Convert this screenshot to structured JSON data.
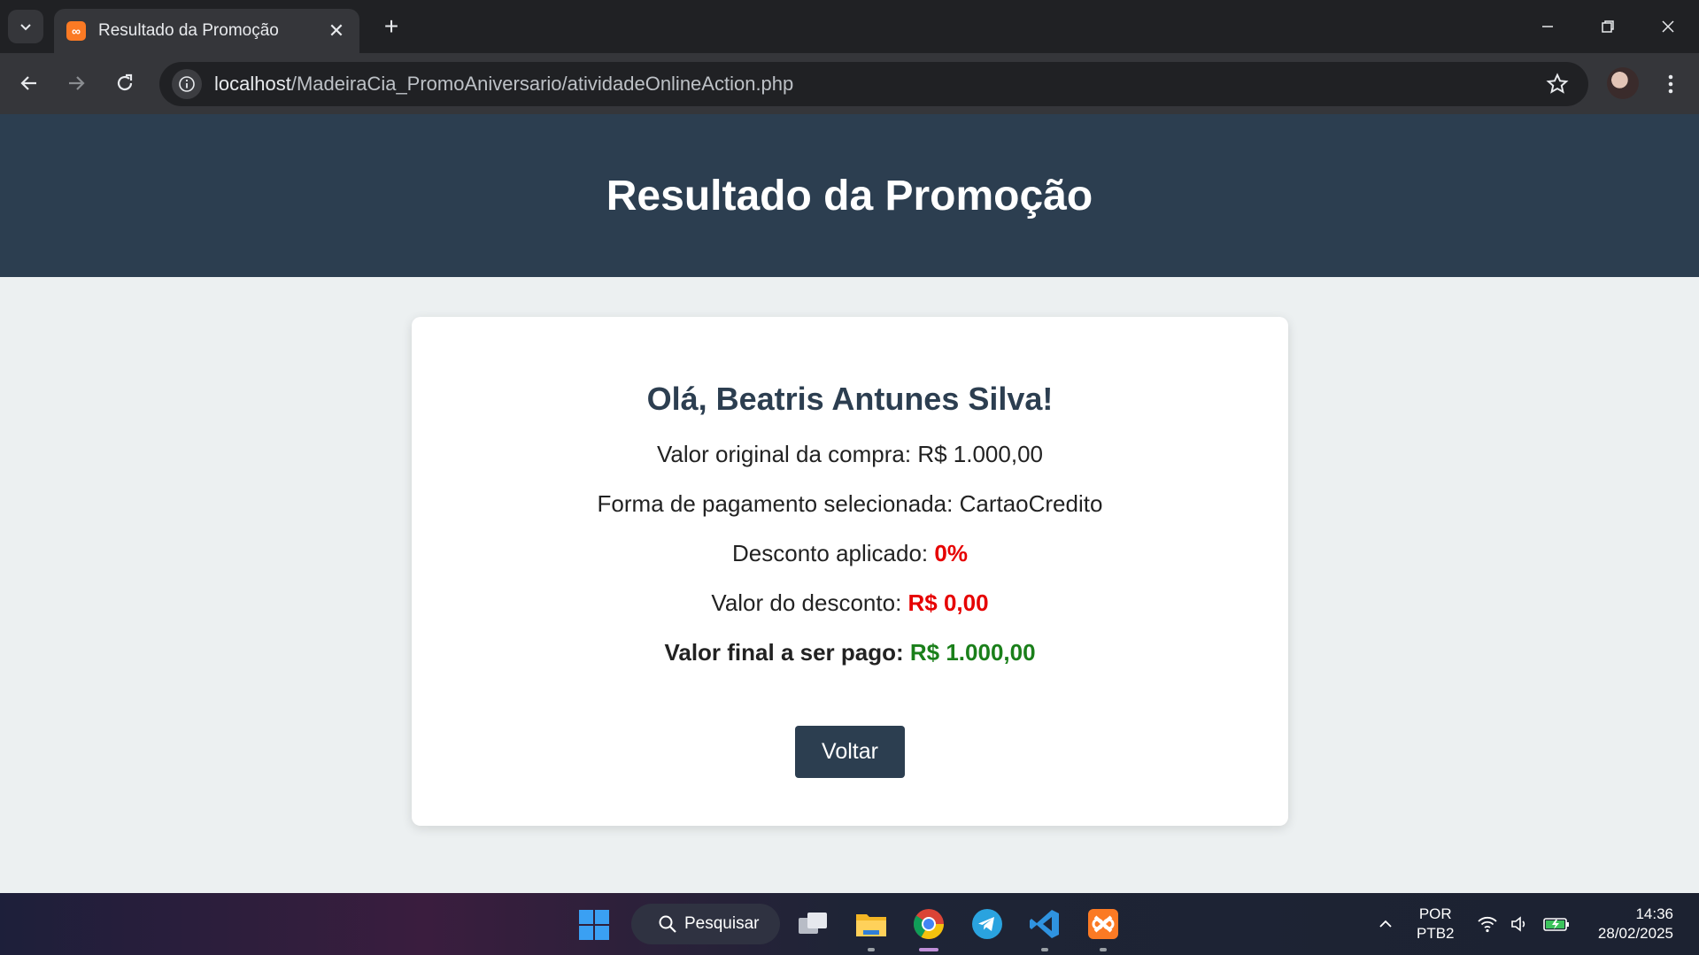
{
  "browser": {
    "tab_title": "Resultado da Promoção",
    "url_host": "localhost",
    "url_path": "/MadeiraCia_PromoAniversario/atividadeOnlineAction.php"
  },
  "page": {
    "title": "Resultado da Promoção",
    "greeting": "Olá, Beatris Antunes Silva!",
    "original_label": "Valor original da compra: ",
    "original_value": "R$ 1.000,00",
    "payment_label": "Forma de pagamento selecionada: ",
    "payment_value": "CartaoCredito",
    "discount_label": "Desconto aplicado: ",
    "discount_value": "0%",
    "discount_amount_label": "Valor do desconto: ",
    "discount_amount_value": "R$ 0,00",
    "final_label": "Valor final a ser pago: ",
    "final_value": "R$ 1.000,00",
    "back_button": "Voltar"
  },
  "taskbar": {
    "search_label": "Pesquisar",
    "lang_line1": "POR",
    "lang_line2": "PTB2",
    "time": "14:36",
    "date": "28/02/2025"
  },
  "colors": {
    "header_bg": "#2c3e50",
    "page_bg": "#ecf0f1",
    "discount_red": "#e60000",
    "final_green": "#1a7f1a"
  }
}
